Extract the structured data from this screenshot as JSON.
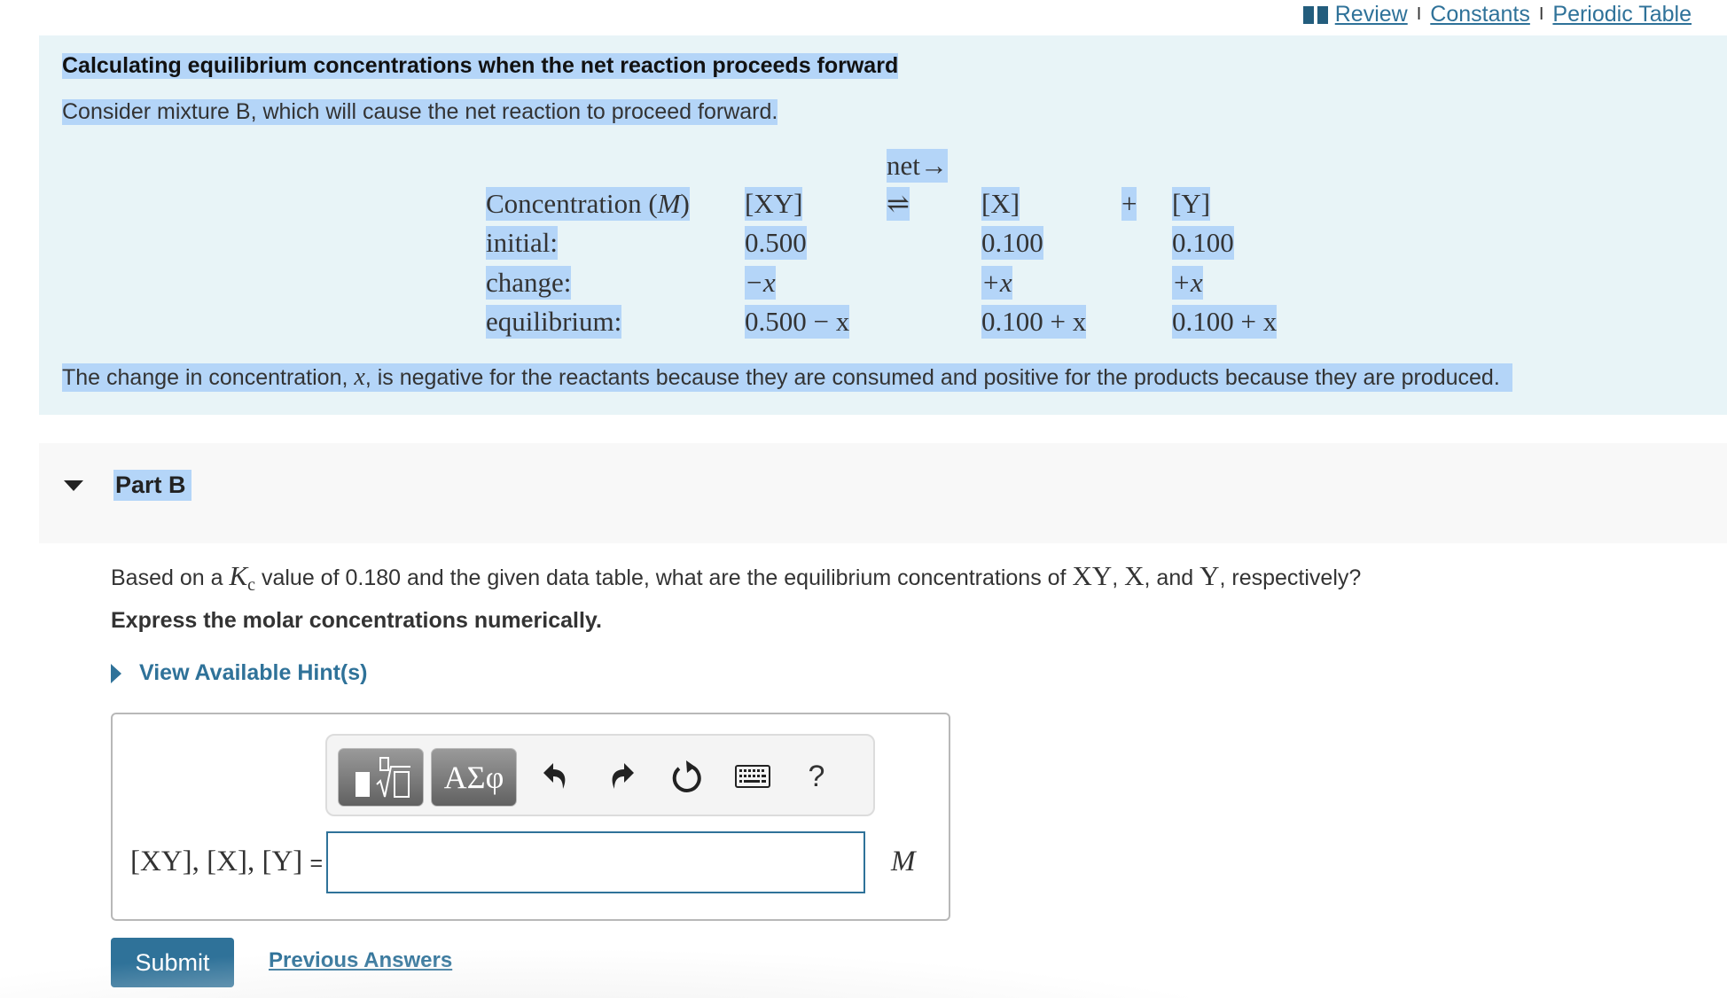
{
  "top_links": {
    "review": "Review",
    "constants": "Constants",
    "periodic_table": "Periodic Table",
    "separator": "I"
  },
  "intro": {
    "title": "Calculating equilibrium concentrations when the net reaction proceeds forward",
    "subtitle": "Consider mixture B, which will cause the net reaction to proceed forward.",
    "explanation_pre": "The change in concentration, ",
    "explanation_var": "x",
    "explanation_post": ", is negative for the reactants because they are consumed and positive for the products because they are produced."
  },
  "ice_table": {
    "direction_label": "net→",
    "header": {
      "label": "Concentration (",
      "unit": "M",
      "label_close": ")",
      "reactant": "[XY]",
      "equilibrium_arrow": "⇌",
      "product1": "[X]",
      "plus": "+",
      "product2": "[Y]"
    },
    "rows": [
      {
        "label": "initial:",
        "xy": "0.500",
        "x": "0.100",
        "y": "0.100"
      },
      {
        "label": "change:",
        "xy": "−x",
        "x": "+x",
        "y": "+x"
      },
      {
        "label": "equilibrium:",
        "xy": "0.500 − x",
        "x": "0.100 + x",
        "y": "0.100 + x"
      }
    ]
  },
  "part": {
    "title": "Part B",
    "question_pre": "Based on a ",
    "kc_symbol": "K",
    "kc_sub": "c",
    "question_mid": " value of 0.180 and the given data table, what are the equilibrium concentrations of ",
    "species1": "XY",
    "comma": ", ",
    "species2": "X",
    "and": ", and ",
    "species3": "Y",
    "question_post": ", respectively?",
    "instruction": "Express the molar concentrations numerically.",
    "hint_label": "View Available Hint(s)"
  },
  "answer": {
    "toolbar": {
      "templates_icon": "templates-icon",
      "symbols_label": "ΑΣφ",
      "undo_icon": "undo-icon",
      "redo_icon": "redo-icon",
      "reset_icon": "reset-icon",
      "keyboard_icon": "keyboard-icon",
      "help_label": "?"
    },
    "label": "[XY], [X], [Y]",
    "equals": "=",
    "value": "",
    "unit": "M"
  },
  "actions": {
    "submit": "Submit",
    "previous_answers": "Previous Answers"
  },
  "colors": {
    "accent": "#2f7299",
    "panel_bg": "#e8f4f7",
    "part_bg": "#f8f8f8",
    "selection": "#b4d5f8"
  }
}
